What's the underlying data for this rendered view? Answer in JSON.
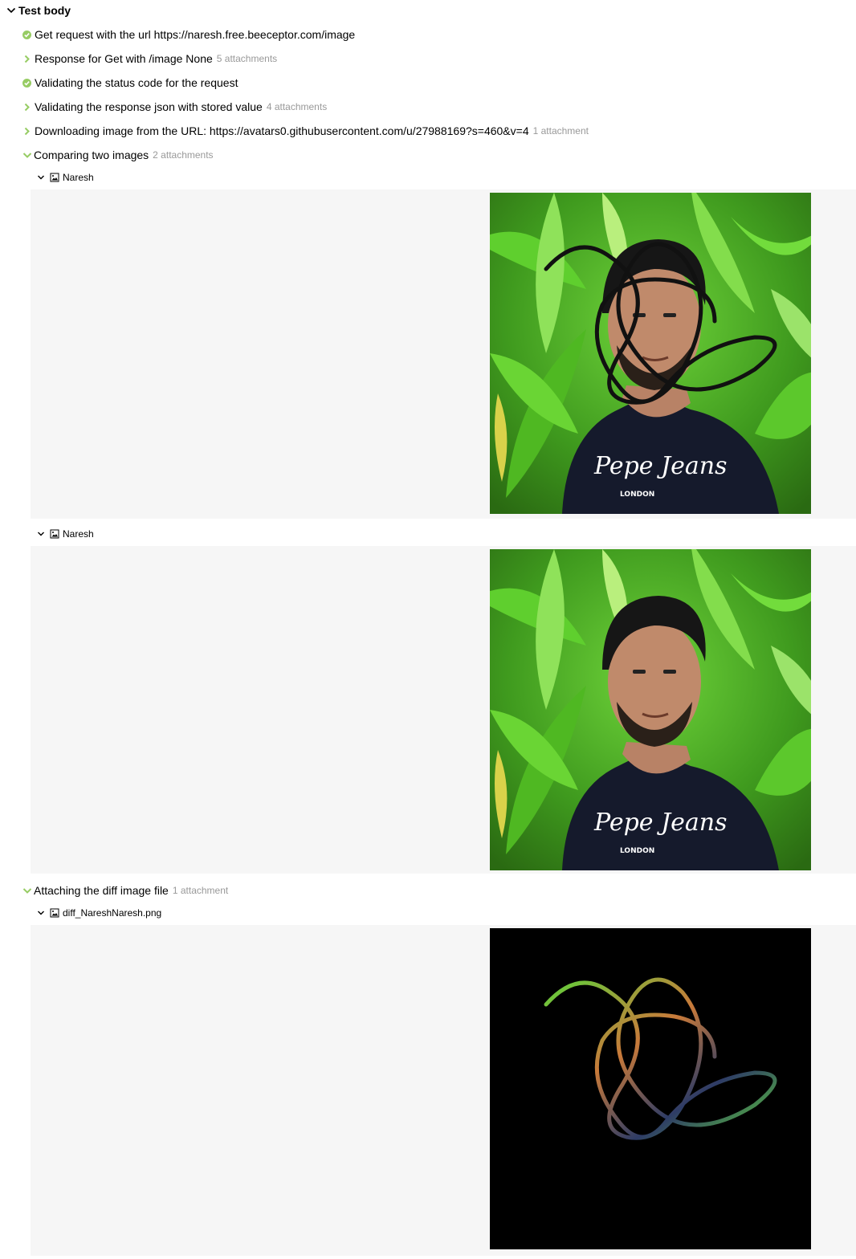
{
  "test_body": {
    "title": "Test body"
  },
  "steps": [
    {
      "label": "Get request with the url https://naresh.free.beeceptor.com/image",
      "count": "",
      "state": "passed"
    },
    {
      "label": "Response for Get with /image None",
      "count": "5 attachments",
      "state": "collapsed"
    },
    {
      "label": "Validating the status code for the request",
      "count": "",
      "state": "passed"
    },
    {
      "label": "Validating the response json with stored value",
      "count": "4 attachments",
      "state": "collapsed"
    },
    {
      "label": "Downloading image from the URL: https://avatars0.githubusercontent.com/u/27988169?s=460&v=4",
      "count": "1 attachment",
      "state": "collapsed"
    },
    {
      "label": "Comparing two images",
      "count": "2 attachments",
      "state": "expanded"
    },
    {
      "label": "Attaching the diff image file",
      "count": "1 attachment",
      "state": "expanded"
    }
  ],
  "attachments": [
    {
      "title": "Naresh",
      "image": "portrait-with-scribble"
    },
    {
      "title": "Naresh",
      "image": "portrait"
    },
    {
      "title": "diff_NareshNaresh.png",
      "image": "diff-image"
    }
  ],
  "shirt_text": {
    "brand": "Pepe Jeans",
    "sub": "LONDON"
  },
  "colors": {
    "pass_green": "#97cc64",
    "muted": "#999999",
    "panel_bg": "#f6f6f6"
  }
}
